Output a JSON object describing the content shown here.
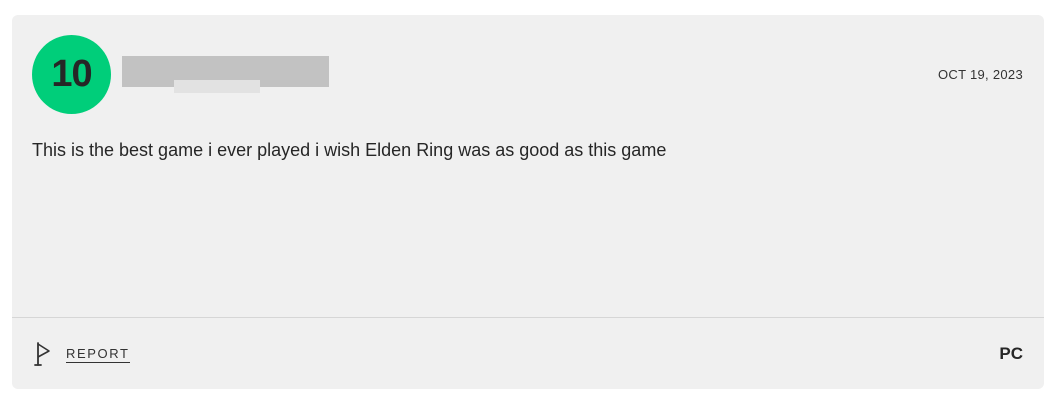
{
  "review": {
    "score": "10",
    "score_color": "#00ce7a",
    "date": "OCT 19, 2023",
    "text": "This is the best game i ever played i wish Elden Ring was as good as this game",
    "platform": "PC"
  },
  "actions": {
    "report_label": "REPORT",
    "report_icon": "flag-icon"
  }
}
